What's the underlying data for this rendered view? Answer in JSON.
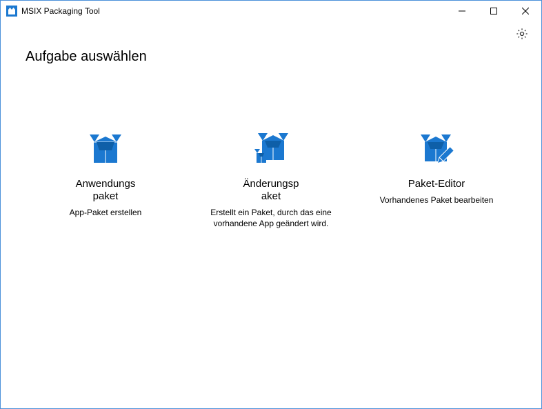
{
  "window": {
    "title": "MSIX Packaging Tool"
  },
  "page": {
    "heading": "Aufgabe auswählen"
  },
  "tasks": [
    {
      "name": "Anwendungs\npaket",
      "desc": "App-Paket erstellen"
    },
    {
      "name": "Änderungsp\naket",
      "desc": "Erstellt ein Paket, durch das eine vorhandene App geändert wird."
    },
    {
      "name": "Paket-Editor",
      "desc": "Vorhandenes Paket bearbeiten"
    }
  ],
  "colors": {
    "accent": "#1b78d0"
  }
}
